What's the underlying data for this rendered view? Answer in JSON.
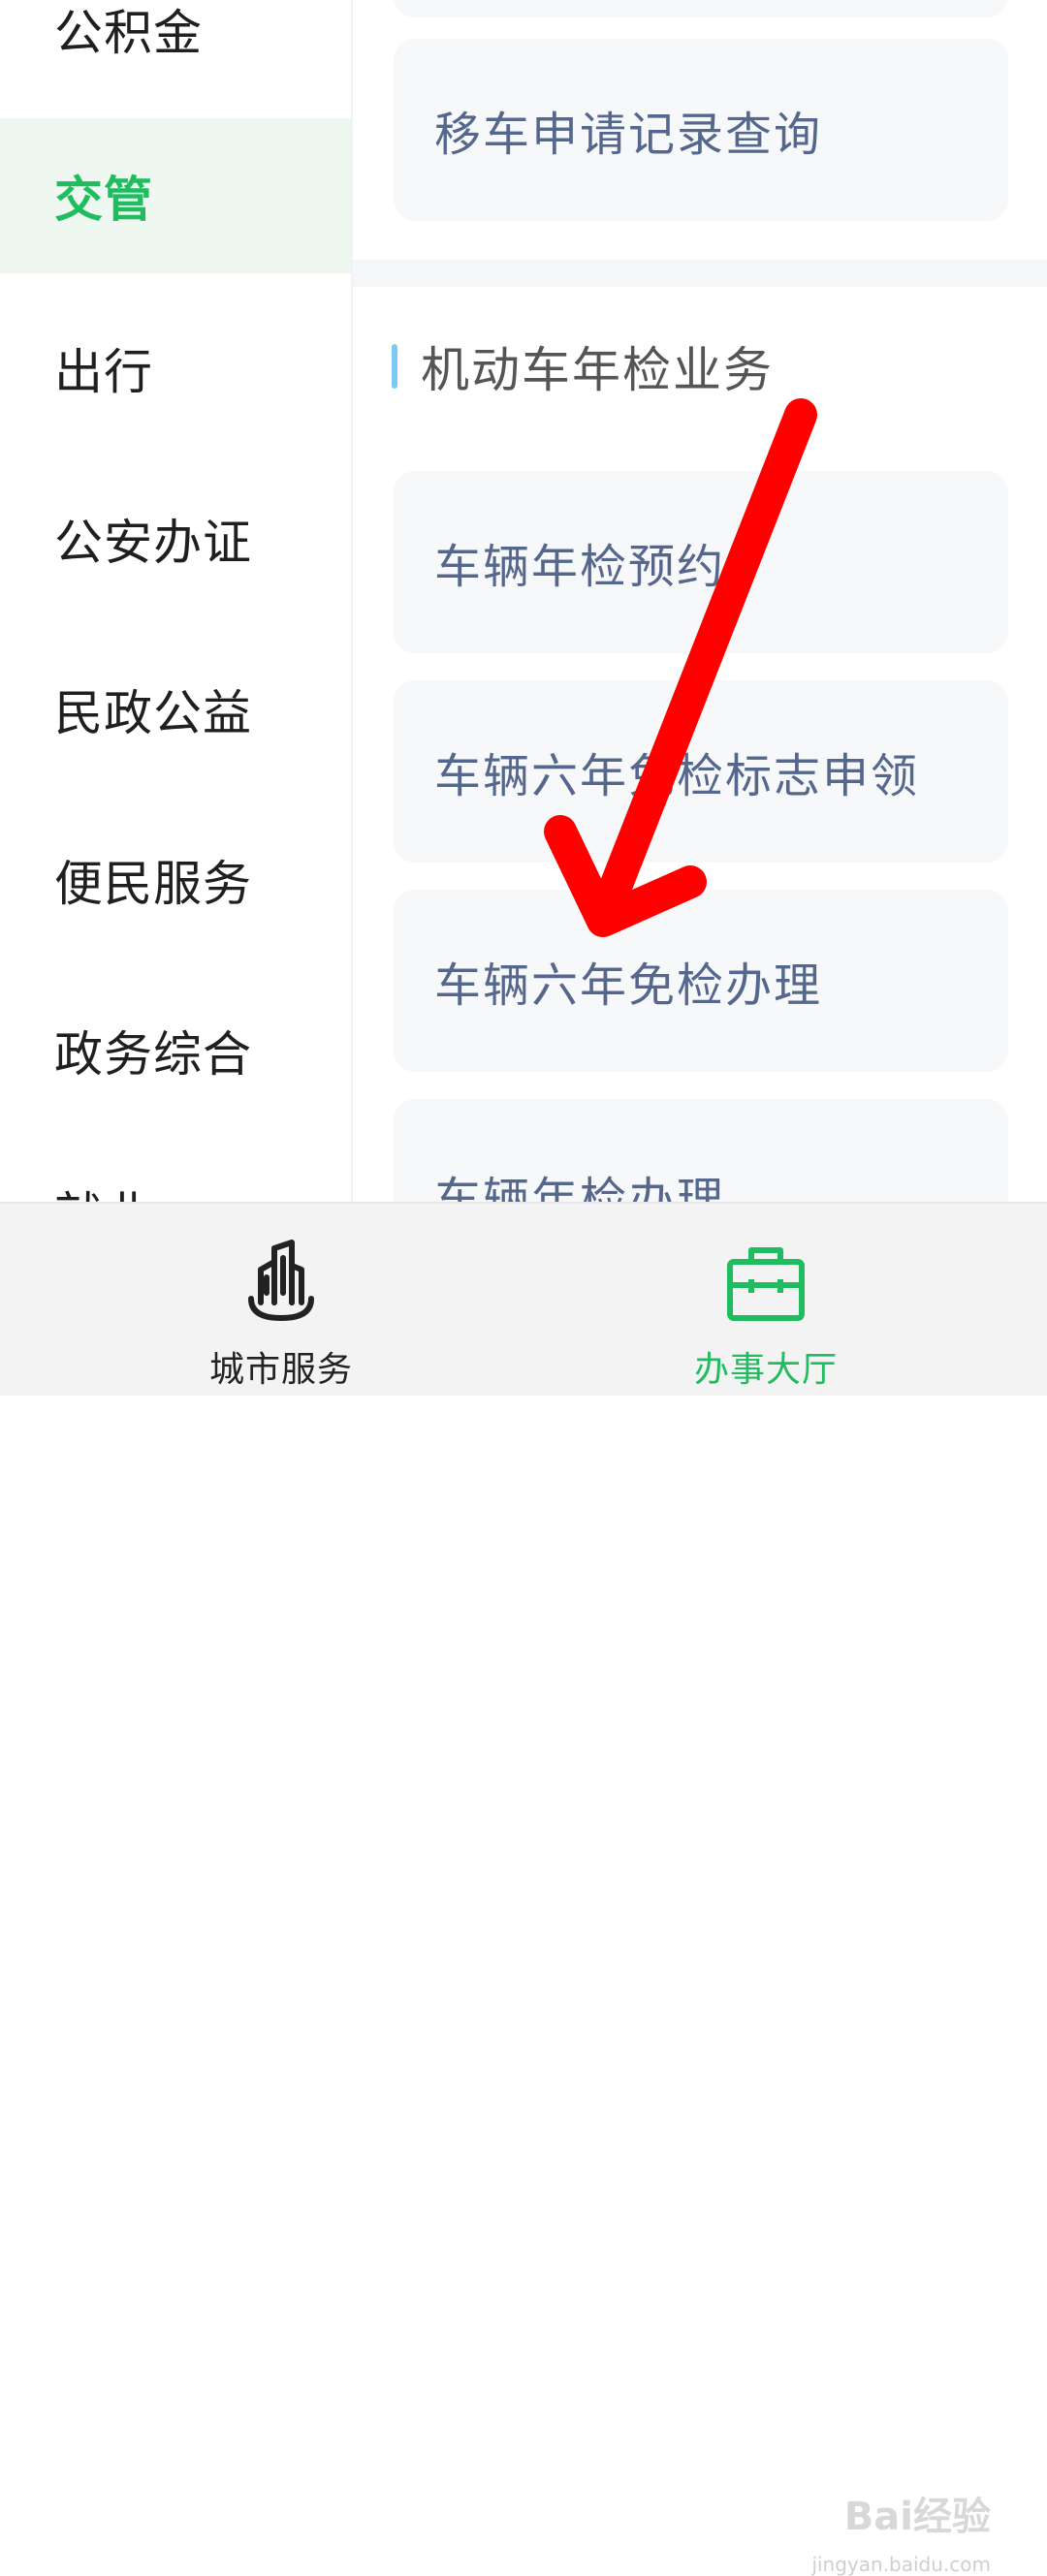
{
  "sidebar": {
    "items": [
      {
        "label": "公积金"
      },
      {
        "label": "交管",
        "active": true
      },
      {
        "label": "出行"
      },
      {
        "label": "公安办证"
      },
      {
        "label": "民政公益"
      },
      {
        "label": "便民服务"
      },
      {
        "label": "政务综合"
      },
      {
        "label": "就业"
      }
    ]
  },
  "main": {
    "top_card": {
      "label": "移车申请记录查询"
    },
    "section": {
      "title": "机动车年检业务",
      "cards": [
        {
          "label": "车辆年检预约"
        },
        {
          "label": "车辆六年免检标志申领"
        },
        {
          "label": "车辆六年免检办理"
        },
        {
          "label": "车辆年检办理"
        }
      ]
    }
  },
  "bottom_nav": {
    "tabs": [
      {
        "label": "城市服务",
        "icon": "city-buildings-icon"
      },
      {
        "label": "办事大厅",
        "icon": "briefcase-icon",
        "active": true
      }
    ]
  },
  "colors": {
    "accent": "#1fbd60",
    "card_text": "#55678c",
    "arrow": "#ff0000"
  },
  "watermark": {
    "brand": "Bai经验",
    "url": "jingyan.baidu.com"
  }
}
